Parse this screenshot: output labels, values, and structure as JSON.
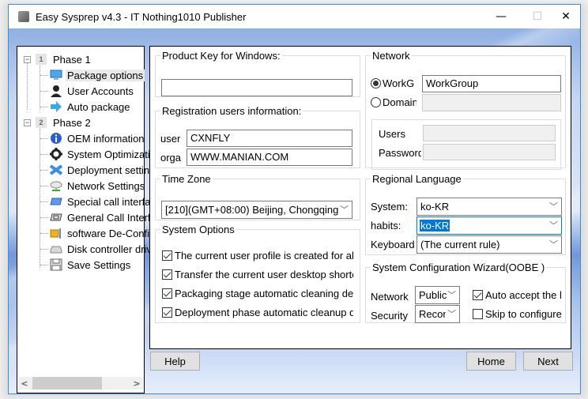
{
  "window": {
    "title": "Easy Sysprep v4.3 - IT Nothing1010 Publisher",
    "controls": {
      "minimize": "—",
      "maximize": "☐",
      "close": "✕"
    }
  },
  "tree": {
    "phases": [
      {
        "number": "1",
        "label": "Phase 1",
        "items": [
          {
            "label": "Package options",
            "icon": "monitor-icon",
            "selected": true
          },
          {
            "label": "User Accounts",
            "icon": "user-icon"
          },
          {
            "label": "Auto package",
            "icon": "arrow-right-icon"
          }
        ]
      },
      {
        "number": "2",
        "label": "Phase 2",
        "items": [
          {
            "label": "OEM information",
            "icon": "info-icon"
          },
          {
            "label": "System Optimization",
            "icon": "gear-icon"
          },
          {
            "label": "Deployment settings",
            "icon": "deploy-icon"
          },
          {
            "label": "Network Settings",
            "icon": "network-cloud-icon"
          },
          {
            "label": "Special call interface",
            "icon": "window-blue-icon"
          },
          {
            "label": "General Call Interface",
            "icon": "window-gray-icon"
          },
          {
            "label": "software De-Configuration",
            "icon": "software-icon"
          },
          {
            "label": "Disk controller driver",
            "icon": "disk-icon"
          },
          {
            "label": "Save Settings",
            "icon": "save-icon"
          }
        ]
      }
    ],
    "scroll_left": "<",
    "scroll_right": ">"
  },
  "product_key": {
    "legend": "Product Key for Windows:",
    "value": ""
  },
  "registration": {
    "legend": "Registration users information:",
    "user_label": "user",
    "user_value": "CXNFLY",
    "org_label": "orga",
    "org_value": "WWW.MANIAN.COM"
  },
  "network": {
    "legend": "Network",
    "workgroup_label": "WorkG",
    "workgroup_selected": true,
    "workgroup_value": "WorkGroup",
    "domain_label": "Domain",
    "domain_value": "",
    "users_label": "Users",
    "users_value": "",
    "password_label": "Password",
    "password_value": ""
  },
  "time_zone": {
    "legend": "Time Zone",
    "value": "[210](GMT+08:00) Beijing, Chongqing"
  },
  "system_options": {
    "legend": "System Options",
    "items": [
      {
        "label": "The current user profile is created for all users",
        "checked": true
      },
      {
        "label": "Transfer the current user desktop shortcuts",
        "checked": true
      },
      {
        "label": "Packaging stage automatic cleaning device",
        "checked": true
      },
      {
        "label": "Deployment phase automatic cleanup drivers",
        "checked": true
      }
    ]
  },
  "regional": {
    "legend": "Regional Language",
    "system_label": "System:",
    "system_value": "ko-KR",
    "habits_label": "habits:",
    "habits_value": "ko-KR",
    "keyboard_label": "Keyboard",
    "keyboard_value": "(The current rule)"
  },
  "oobe": {
    "legend": "System Configuration Wizard(OOBE )",
    "network_label": "Network",
    "network_value": "Public",
    "security_label": "Security",
    "security_value": "Recommended",
    "auto_accept_label": "Auto accept the license",
    "auto_accept_checked": true,
    "skip_label": "Skip to configure",
    "skip_checked": false
  },
  "buttons": {
    "help": "Help",
    "home": "Home",
    "next": "Next"
  }
}
